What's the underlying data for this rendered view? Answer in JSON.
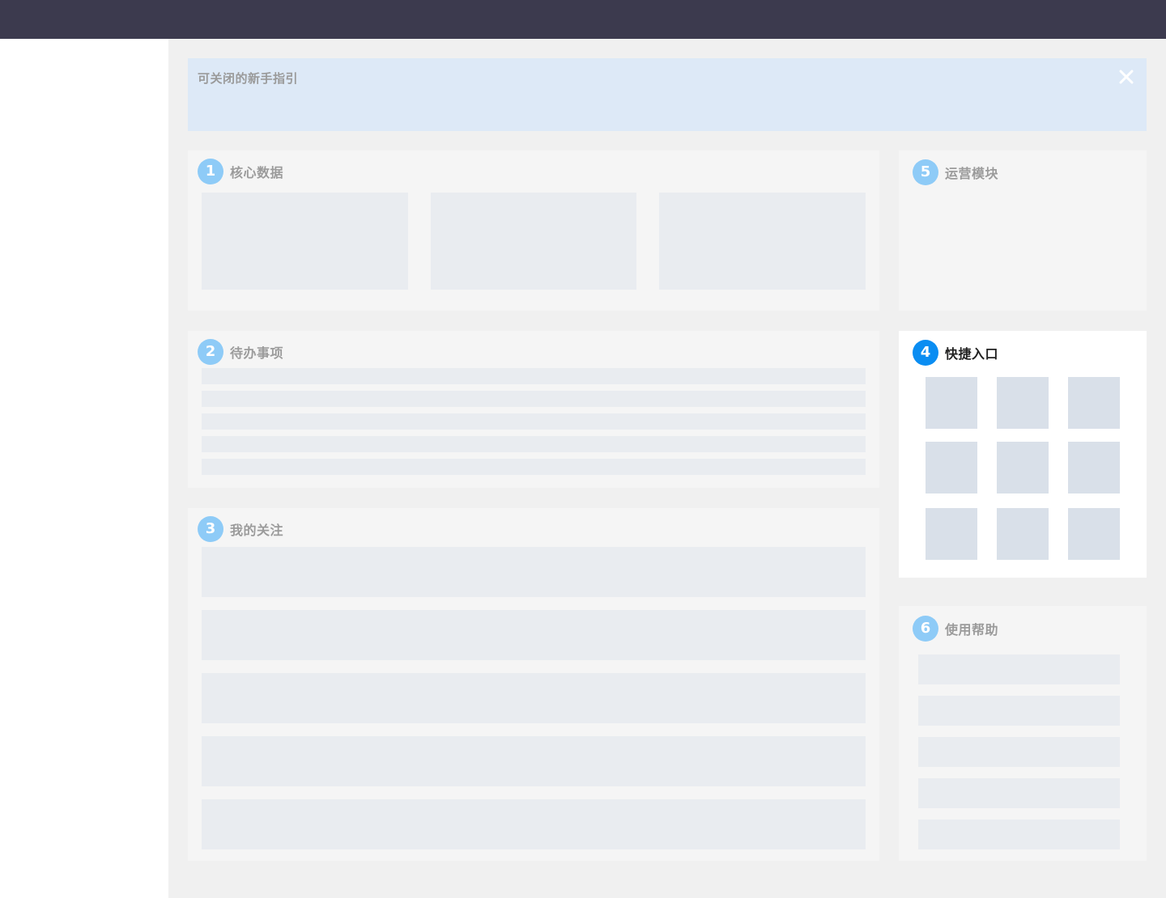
{
  "guide": {
    "title": "可关闭的新手指引",
    "close_icon": "close-icon"
  },
  "cards": {
    "core_data": {
      "number": "1",
      "title": "核心数据"
    },
    "todo": {
      "number": "2",
      "title": "待办事项"
    },
    "following": {
      "number": "3",
      "title": "我的关注"
    },
    "shortcuts": {
      "number": "4",
      "title": "快捷入口"
    },
    "operations": {
      "number": "5",
      "title": "运营模块"
    },
    "help": {
      "number": "6",
      "title": "使用帮助"
    }
  },
  "colors": {
    "topbar": "#3c3a4e",
    "badge_default": "#8ecbf7",
    "badge_active": "#0a8df2",
    "guide_bg": "#dde9f7"
  }
}
